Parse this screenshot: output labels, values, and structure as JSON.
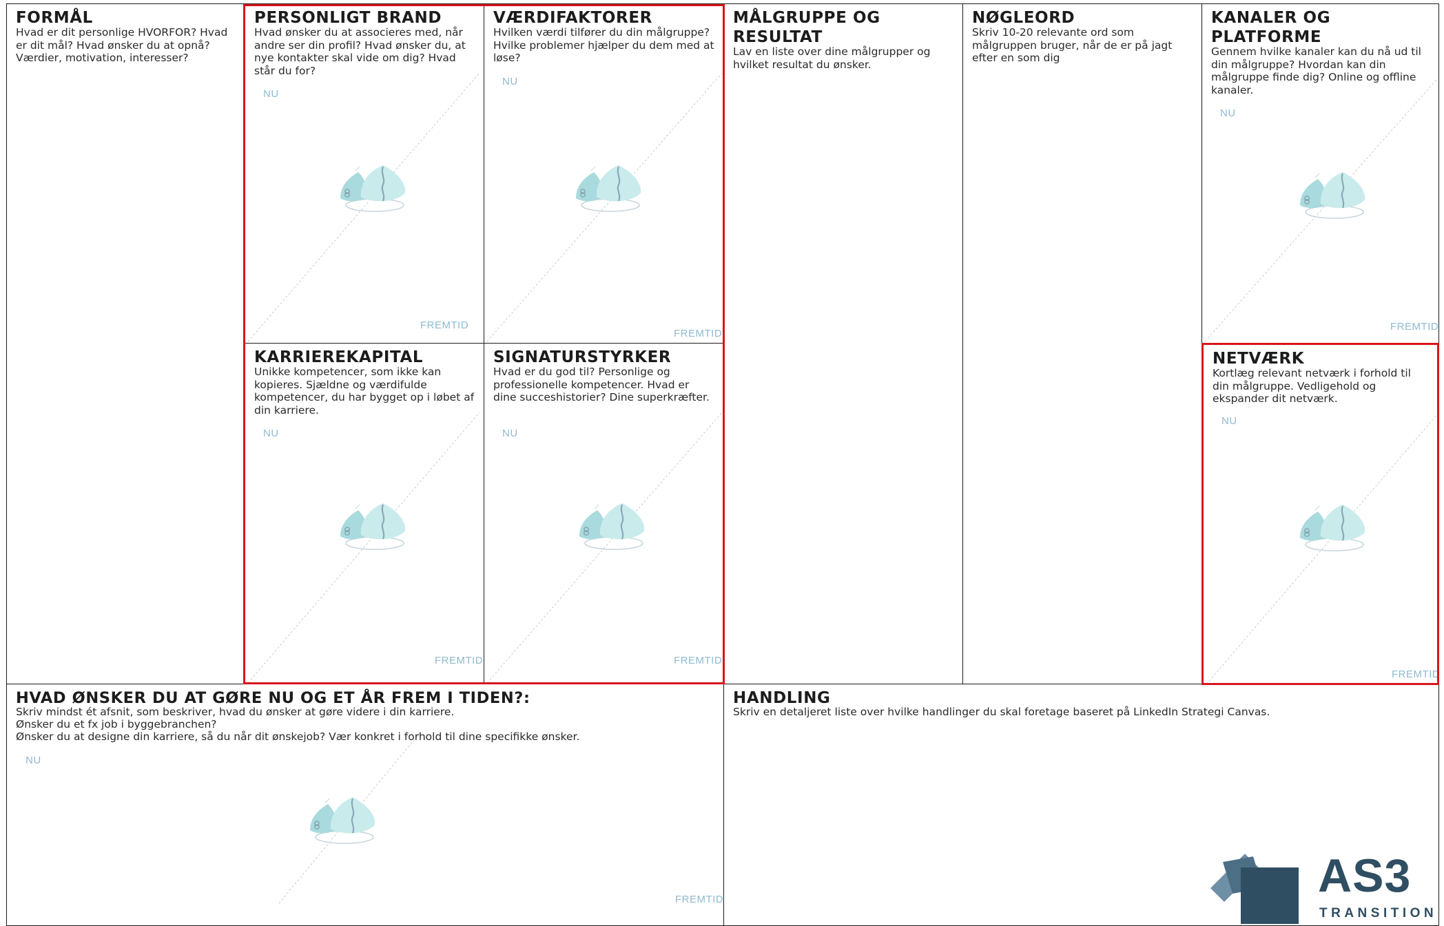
{
  "sections": {
    "formaal": {
      "title": "FORMÅL",
      "desc": "Hvad er dit personlige HVORFOR? Hvad er dit mål? Hvad ønsker du at opnå? Værdier, motivation, interesser?"
    },
    "personligt_brand": {
      "title": "PERSONLIGT BRAND",
      "desc": "Hvad ønsker du at associeres med, når andre ser din profil? Hvad ønsker du, at nye kontakter skal vide om dig? Hvad står du for?",
      "nu": "NU",
      "fremtid": "FREMTID"
    },
    "vaerdifaktorer": {
      "title": "VÆRDIFAKTORER",
      "desc": "Hvilken værdi tilfører du din målgruppe? Hvilke problemer hjælper du dem med at løse?",
      "nu": "NU",
      "fremtid": "FREMTID"
    },
    "maalgruppe": {
      "title": "MÅLGRUPPE OG RESULTAT",
      "desc": "Lav en liste over dine målgrupper og hvilket resultat du ønsker."
    },
    "noegleord": {
      "title": "NØGLEORD",
      "desc": "Skriv 10-20 relevante ord som målgruppen bruger, når de er på jagt efter en som dig"
    },
    "kanaler": {
      "title": "KANALER OG PLATFORME",
      "desc": "Gennem hvilke kanaler kan du nå ud til din målgruppe? Hvordan kan din målgruppe finde dig? Online og offline kanaler.",
      "nu": "NU",
      "fremtid": "FREMTID"
    },
    "karrierekapital": {
      "title": "KARRIEREKAPITAL",
      "desc": "Unikke kompetencer, som ikke kan kopieres. Sjældne og værdifulde kompetencer, du har bygget op i løbet af din karriere.",
      "nu": "NU",
      "fremtid": "FREMTID"
    },
    "signaturstyrker": {
      "title": "SIGNATURSTYRKER",
      "desc": "Hvad er du god til? Personlige og professionelle kompetencer. Hvad er dine succeshistorier? Dine superkræfter.",
      "nu": "NU",
      "fremtid": "FREMTID"
    },
    "netvaerk": {
      "title": "NETVÆRK",
      "desc": "Kortlæg relevant netværk i forhold til din målgruppe. Vedligehold og ekspander dit netværk.",
      "nu": "NU",
      "fremtid": "FREMTID"
    },
    "hvad_oensker": {
      "title": "HVAD ØNSKER DU AT GØRE NU OG ET ÅR FREM I TIDEN?:",
      "line1": "Skriv mindst ét afsnit, som beskriver, hvad du ønsker at gøre videre i din karriere.",
      "line2": "Ønsker du et fx job i byggebranchen?",
      "line3": "Ønsker du at designe din karriere, så du når dit ønskejob? Vær konkret i forhold til dine specifikke ønsker.",
      "nu": "NU",
      "fremtid": "FREMTID"
    },
    "handling": {
      "title": "HANDLING",
      "desc": "Skriv en detaljeret liste over hvilke handlinger du skal foretage baseret på LinkedIn Strategi Canvas."
    }
  },
  "logo": {
    "main": "AS3",
    "sub": "TRANSITION"
  },
  "colors": {
    "border": "#1a1a1a",
    "highlight": "#d9141b",
    "accent_text": "#8fbad0",
    "logo": "#2f4e62",
    "mountain_a": "#a9dadd",
    "mountain_b": "#c9ebec"
  }
}
